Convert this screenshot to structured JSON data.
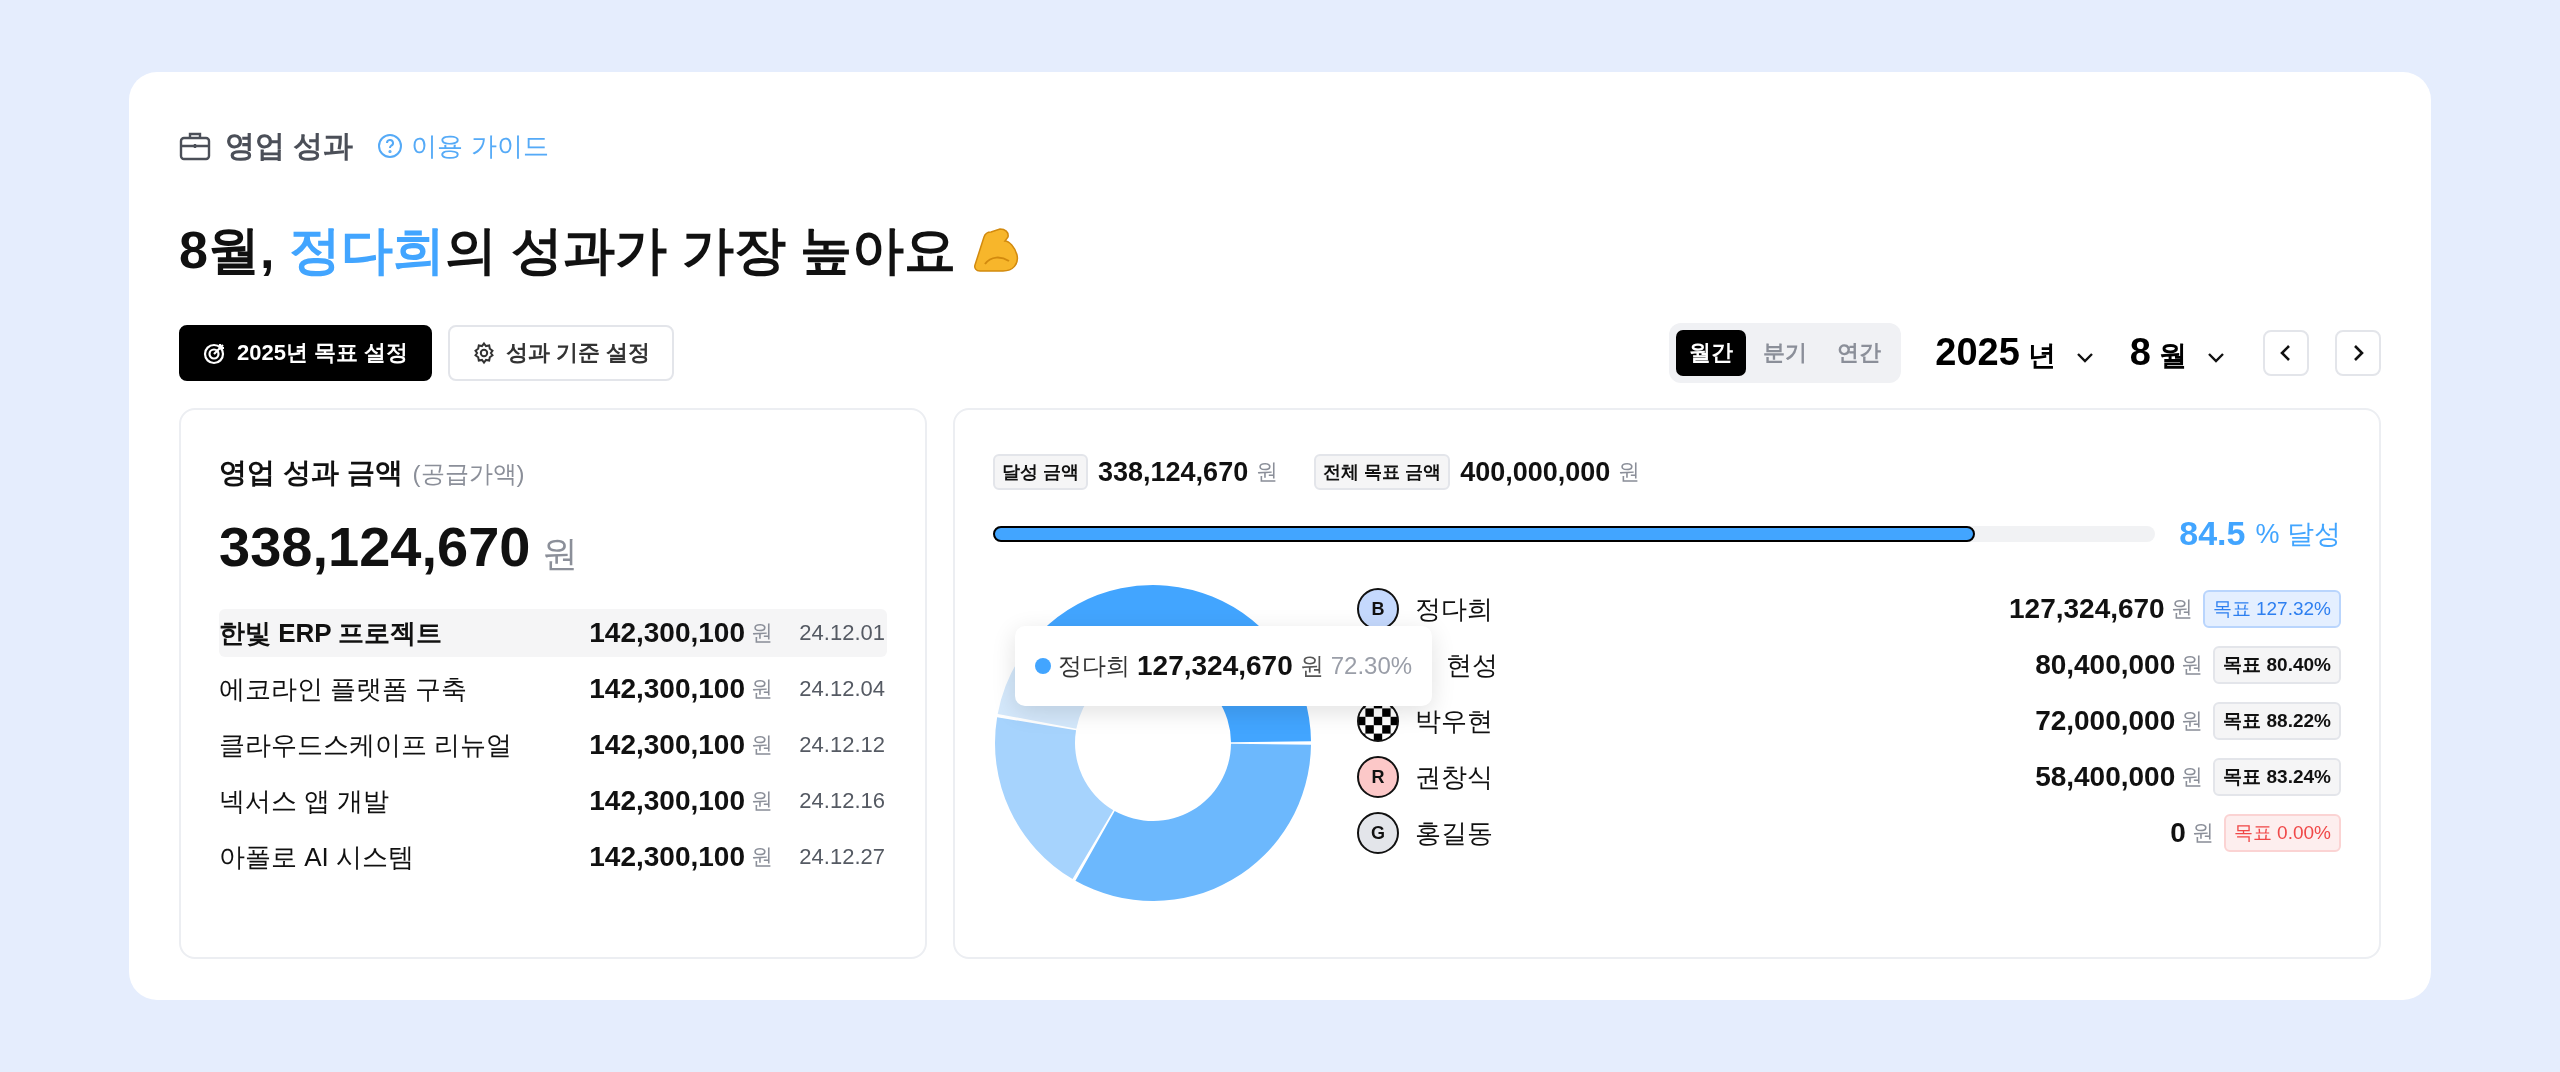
{
  "header": {
    "title": "영업 성과",
    "guide_link": "이용 가이드"
  },
  "headline": [
    {
      "text": "8월, ",
      "highlight": false
    },
    {
      "text": "정다희",
      "highlight": true
    },
    {
      "text": "의 성과가 가장 높아요",
      "highlight": false
    }
  ],
  "actions": [
    {
      "kind": "primary",
      "label": "2025년 목표 설정"
    },
    {
      "kind": "secondary",
      "label": "성과 기준 설정"
    }
  ],
  "period_tabs": [
    {
      "label": "월간",
      "selected": true
    },
    {
      "label": "분기",
      "selected": false
    },
    {
      "label": "연간",
      "selected": false
    }
  ],
  "year_select": {
    "value": "2025",
    "unit": "년"
  },
  "month_select": {
    "value": "8",
    "unit": "월"
  },
  "summary": {
    "title": "영업 성과 금액",
    "subtitle": "(공급가액)",
    "amount": "338,124,670",
    "unit": "원",
    "projects": [
      {
        "name": "한빛 ERP 프로젝트",
        "amount": "142,300,100",
        "unit": "원",
        "date": "24.12.01",
        "selected": true
      },
      {
        "name": "에코라인 플랫폼 구축",
        "amount": "142,300,100",
        "unit": "원",
        "date": "24.12.04",
        "selected": false
      },
      {
        "name": "클라우드스케이프 리뉴얼",
        "amount": "142,300,100",
        "unit": "원",
        "date": "24.12.12",
        "selected": false
      },
      {
        "name": "넥서스 앱 개발",
        "amount": "142,300,100",
        "unit": "원",
        "date": "24.12.16",
        "selected": false
      },
      {
        "name": "아폴로 AI 시스템",
        "amount": "142,300,100",
        "unit": "원",
        "date": "24.12.27",
        "selected": false
      }
    ]
  },
  "goal": {
    "achieved_label": "달성 금액",
    "achieved_amount": "338,124,670",
    "achieved_unit": "원",
    "target_label": "전체 목표 금액",
    "target_amount": "400,000,000",
    "target_unit": "원",
    "level": 0.845,
    "percent": "84.5",
    "percent_suffix": "% 달성"
  },
  "members": [
    {
      "avatar": {
        "kind": "letter",
        "letter": "B",
        "color": "#c5d9fd"
      },
      "name": "정다희",
      "amount": "127,324,670",
      "unit": "원",
      "badge": "목표 127.32%",
      "kind": "exceeded"
    },
    {
      "name": "현성",
      "covered": true,
      "amount": "80,400,000",
      "unit": "원",
      "badge": "목표 80.40%",
      "kind": "normal"
    },
    {
      "avatar": {
        "kind": "checker"
      },
      "name": "박우현",
      "amount": "72,000,000",
      "unit": "원",
      "badge": "목표 88.22%",
      "kind": "normal"
    },
    {
      "avatar": {
        "kind": "letter",
        "letter": "R",
        "color": "#fcc8c8"
      },
      "name": "권창식",
      "amount": "58,400,000",
      "unit": "원",
      "badge": "목표 83.24%",
      "kind": "normal"
    },
    {
      "avatar": {
        "kind": "letter",
        "letter": "G",
        "color": "#e3e5ea"
      },
      "name": "홍길동",
      "amount": "0",
      "unit": "원",
      "badge": "목표 0.00%",
      "kind": "none"
    }
  ],
  "tooltip": {
    "color": "#42a5ff",
    "name": "정다희",
    "amount": "127,324,670",
    "unit": "원",
    "percent": "72.30%"
  }
}
